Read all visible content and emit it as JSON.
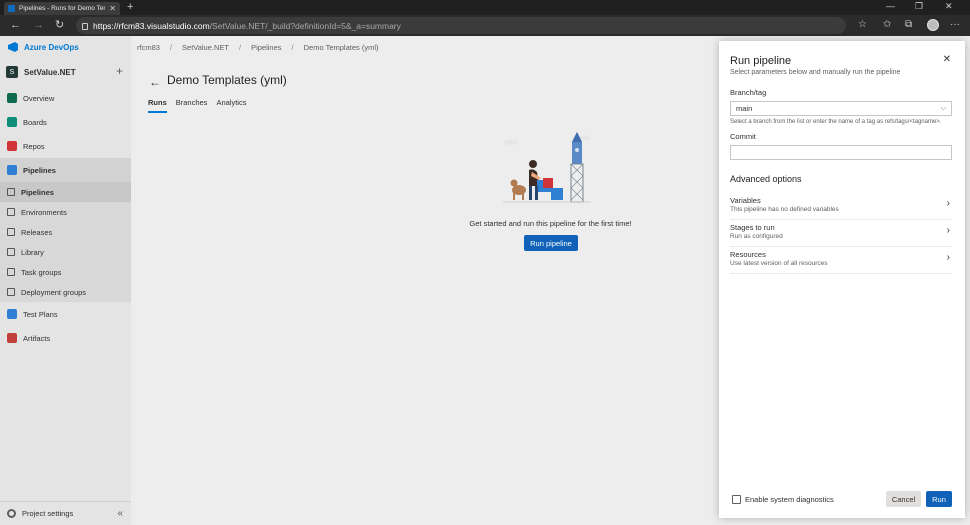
{
  "browser": {
    "tab_title": "Pipelines - Runs for Demo Temp",
    "url_host": "https://rfcm83.visualstudio.com",
    "url_path": "/SetValue.NET/_build?definitionId=5&_a=summary"
  },
  "nav": {
    "brand": "Azure DevOps",
    "project": "SetValue.NET",
    "project_initial": "S",
    "items": [
      {
        "label": "Overview",
        "color": "#0f6b4f"
      },
      {
        "label": "Boards",
        "color": "#0f8d78"
      },
      {
        "label": "Repos",
        "color": "#d13438"
      },
      {
        "label": "Pipelines",
        "color": "#2f7fd3"
      }
    ],
    "pipelines_sub": [
      "Pipelines",
      "Environments",
      "Releases",
      "Library",
      "Task groups",
      "Deployment groups"
    ],
    "items_after": [
      {
        "label": "Test Plans",
        "color": "#2f7fd3"
      },
      {
        "label": "Artifacts",
        "color": "#c1403b"
      }
    ],
    "project_settings": "Project settings"
  },
  "breadcrumb": [
    "rfcm83",
    "SetValue.NET",
    "Pipelines",
    "Demo Templates (yml)"
  ],
  "page": {
    "title": "Demo Templates (yml)",
    "tabs": [
      "Runs",
      "Branches",
      "Analytics"
    ],
    "empty_message": "Get started and run this pipeline for the first time!",
    "run_button": "Run pipeline"
  },
  "panel": {
    "title": "Run pipeline",
    "subtitle": "Select parameters below and manually run the pipeline",
    "branch_label": "Branch/tag",
    "branch_value": "main",
    "branch_hint": "Select a branch from the list or enter the name of a tag as refs/tags/<tagname>.",
    "commit_label": "Commit",
    "advanced_title": "Advanced options",
    "options": [
      {
        "title": "Variables",
        "sub": "This pipeline has no defined variables"
      },
      {
        "title": "Stages to run",
        "sub": "Run as configured"
      },
      {
        "title": "Resources",
        "sub": "Use latest version of all resources"
      }
    ],
    "diagnostics_label": "Enable system diagnostics",
    "cancel": "Cancel",
    "run": "Run"
  }
}
